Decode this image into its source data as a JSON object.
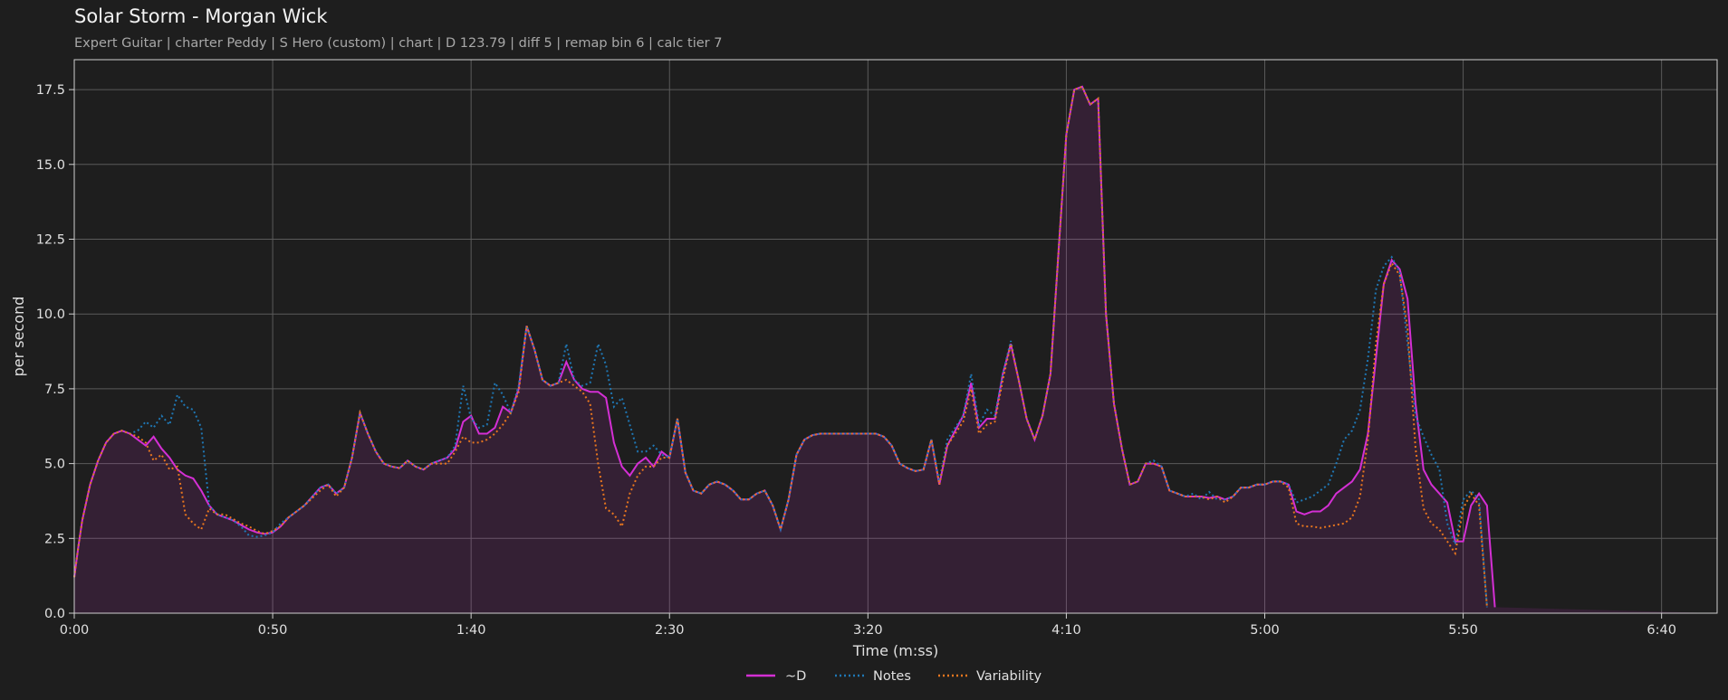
{
  "chart_data": {
    "type": "line",
    "title": "Solar Storm - Morgan Wick",
    "subtitle": "Expert Guitar  |  charter Peddy  |  S Hero (custom)  |  chart  |  D 123.79  |  diff 5  |  remap bin 6  |  calc tier 7",
    "xlabel": "Time (m:ss)",
    "ylabel": "per second",
    "xlim": [
      0,
      414
    ],
    "ylim": [
      0,
      18.5
    ],
    "x_ticks": [
      0,
      50,
      100,
      150,
      200,
      250,
      300,
      350,
      400
    ],
    "x_tick_labels": [
      "0:00",
      "0:50",
      "1:40",
      "2:30",
      "3:20",
      "4:10",
      "5:00",
      "5:50",
      "6:40"
    ],
    "y_ticks": [
      0,
      2.5,
      5,
      7.5,
      10,
      12.5,
      15,
      17.5
    ],
    "y_tick_labels": [
      "0.0",
      "2.5",
      "5.0",
      "7.5",
      "10.0",
      "12.5",
      "15.0",
      "17.5"
    ],
    "grid": true,
    "legend_position": "bottom-center",
    "x": [
      0,
      1,
      2,
      4,
      6,
      8,
      10,
      12,
      14,
      16,
      18,
      20,
      22,
      24,
      26,
      28,
      30,
      32,
      34,
      36,
      38,
      40,
      42,
      44,
      46,
      48,
      50,
      52,
      54,
      56,
      58,
      60,
      62,
      64,
      66,
      68,
      70,
      72,
      74,
      76,
      78,
      80,
      82,
      84,
      86,
      88,
      90,
      92,
      94,
      96,
      98,
      100,
      102,
      104,
      106,
      108,
      110,
      112,
      114,
      116,
      118,
      120,
      122,
      124,
      126,
      128,
      130,
      132,
      134,
      136,
      138,
      140,
      142,
      144,
      146,
      148,
      150,
      152,
      154,
      156,
      158,
      160,
      162,
      164,
      166,
      168,
      170,
      172,
      174,
      176,
      178,
      180,
      182,
      184,
      186,
      188,
      190,
      192,
      194,
      196,
      198,
      200,
      202,
      204,
      206,
      208,
      210,
      212,
      214,
      216,
      218,
      220,
      222,
      224,
      226,
      228,
      230,
      232,
      234,
      236,
      238,
      240,
      242,
      244,
      246,
      248,
      250,
      252,
      254,
      256,
      258,
      260,
      262,
      264,
      266,
      268,
      270,
      272,
      274,
      276,
      278,
      280,
      282,
      284,
      286,
      288,
      290,
      292,
      294,
      296,
      298,
      300,
      302,
      304,
      306,
      308,
      310,
      312,
      314,
      316,
      318,
      320,
      322,
      324,
      326,
      328,
      330,
      332,
      334,
      336,
      338,
      340,
      342,
      344,
      346,
      348,
      350,
      352,
      354,
      356,
      358,
      360,
      362,
      364,
      366,
      368,
      370,
      372,
      374,
      376,
      378,
      380,
      382,
      384,
      386,
      388,
      390,
      392,
      394,
      396,
      398,
      400,
      402,
      404,
      406,
      408,
      410,
      412,
      414
    ],
    "series": [
      {
        "name": "~D",
        "color": "#d42fd4",
        "style": "solid",
        "values": [
          1.2,
          2.2,
          3.1,
          4.3,
          5.1,
          5.7,
          6.0,
          6.1,
          6.0,
          5.8,
          5.6,
          5.9,
          5.5,
          5.2,
          4.8,
          4.6,
          4.5,
          4.1,
          3.6,
          3.3,
          3.2,
          3.1,
          2.95,
          2.8,
          2.7,
          2.65,
          2.7,
          2.9,
          3.2,
          3.4,
          3.6,
          3.9,
          4.2,
          4.3,
          4.0,
          4.2,
          5.2,
          6.7,
          6.0,
          5.4,
          5.0,
          4.9,
          4.85,
          5.1,
          4.9,
          4.8,
          5.0,
          5.1,
          5.2,
          5.5,
          6.4,
          6.6,
          6.0,
          6.0,
          6.2,
          6.9,
          6.7,
          7.5,
          9.6,
          8.8,
          7.8,
          7.6,
          7.7,
          8.4,
          7.8,
          7.5,
          7.4,
          7.4,
          7.2,
          5.7,
          4.9,
          4.6,
          5.0,
          5.2,
          4.9,
          5.4,
          5.2,
          6.5,
          4.7,
          4.1,
          4.0,
          4.3,
          4.4,
          4.3,
          4.1,
          3.8,
          3.8,
          4.0,
          4.1,
          3.6,
          2.8,
          3.8,
          5.3,
          5.8,
          5.95,
          6.0,
          6.0,
          6.0,
          6.0,
          6.0,
          6.0,
          6.0,
          6.0,
          5.9,
          5.6,
          5.0,
          4.85,
          4.75,
          4.8,
          5.8,
          4.3,
          5.6,
          6.1,
          6.6,
          7.7,
          6.2,
          6.5,
          6.5,
          8.0,
          9.0,
          7.8,
          6.5,
          5.8,
          6.6,
          8.0,
          12.0,
          16.0,
          17.5,
          17.6,
          17.0,
          17.2,
          10.0,
          7.0,
          5.5,
          4.3,
          4.4,
          5.0,
          5.0,
          4.9,
          4.1,
          4.0,
          3.9,
          3.9,
          3.9,
          3.85,
          3.9,
          3.8,
          3.9,
          4.2,
          4.2,
          4.3,
          4.3,
          4.4,
          4.4,
          4.3,
          3.4,
          3.3,
          3.4,
          3.4,
          3.6,
          4.0,
          4.2,
          4.4,
          4.8,
          6.0,
          8.5,
          11.0,
          11.8,
          11.5,
          10.5,
          7.0,
          4.8,
          4.3,
          4.0,
          3.7,
          2.4,
          2.4,
          3.6,
          4.0,
          3.6,
          0.2
        ]
      },
      {
        "name": "Notes",
        "color": "#1f77b4",
        "style": "dotted",
        "values": [
          1.2,
          2.2,
          3.1,
          4.3,
          5.1,
          5.7,
          6.0,
          6.1,
          6.0,
          6.1,
          6.4,
          6.2,
          6.6,
          6.3,
          7.3,
          6.9,
          6.8,
          6.2,
          3.6,
          3.3,
          3.2,
          3.1,
          2.9,
          2.6,
          2.55,
          2.6,
          2.7,
          3.0,
          3.2,
          3.4,
          3.6,
          3.9,
          4.2,
          4.3,
          4.0,
          4.2,
          5.2,
          6.7,
          6.0,
          5.4,
          5.0,
          4.9,
          4.85,
          5.1,
          4.9,
          4.8,
          5.0,
          5.1,
          5.2,
          5.6,
          7.6,
          6.5,
          6.2,
          6.3,
          7.7,
          7.3,
          6.7,
          7.6,
          9.6,
          8.8,
          7.8,
          7.6,
          7.7,
          9.0,
          7.8,
          7.6,
          7.7,
          9.0,
          8.3,
          6.9,
          7.2,
          6.3,
          5.4,
          5.4,
          5.6,
          5.3,
          5.2,
          6.5,
          4.7,
          4.1,
          4.0,
          4.3,
          4.4,
          4.3,
          4.1,
          3.8,
          3.8,
          4.0,
          4.1,
          3.6,
          2.8,
          3.8,
          5.3,
          5.8,
          5.95,
          6.0,
          6.0,
          6.0,
          6.0,
          6.0,
          6.0,
          6.0,
          6.0,
          5.9,
          5.6,
          5.0,
          4.85,
          4.75,
          4.8,
          5.8,
          4.4,
          5.8,
          6.2,
          6.6,
          8.0,
          6.3,
          6.8,
          6.6,
          8.0,
          9.1,
          7.8,
          6.5,
          5.8,
          6.6,
          8.0,
          12.0,
          16.0,
          17.5,
          17.6,
          17.0,
          17.2,
          10.0,
          7.0,
          5.5,
          4.3,
          4.4,
          5.0,
          5.1,
          4.9,
          4.1,
          4.0,
          3.9,
          4.0,
          3.8,
          4.05,
          3.8,
          3.8,
          3.9,
          4.2,
          4.2,
          4.3,
          4.3,
          4.4,
          4.4,
          4.3,
          3.7,
          3.8,
          3.9,
          4.1,
          4.3,
          5.0,
          5.8,
          6.1,
          6.8,
          8.5,
          10.8,
          11.6,
          11.9,
          11.4,
          9.0,
          6.6,
          5.9,
          5.3,
          4.8,
          3.0,
          2.3,
          3.8,
          4.1,
          3.8,
          0.2
        ]
      },
      {
        "name": "Variability",
        "color": "#e8761e",
        "style": "dotted",
        "values": [
          1.2,
          2.2,
          3.1,
          4.3,
          5.1,
          5.7,
          6.0,
          6.1,
          6.0,
          5.9,
          5.7,
          5.1,
          5.3,
          4.8,
          4.9,
          3.3,
          3.0,
          2.8,
          3.5,
          3.3,
          3.3,
          3.15,
          3.0,
          2.9,
          2.75,
          2.65,
          2.75,
          2.9,
          3.2,
          3.4,
          3.6,
          3.85,
          4.1,
          4.3,
          3.9,
          4.2,
          5.2,
          6.7,
          6.0,
          5.4,
          5.0,
          4.9,
          4.85,
          5.1,
          4.9,
          4.8,
          5.0,
          5.0,
          5.0,
          5.4,
          5.9,
          5.7,
          5.7,
          5.8,
          6.0,
          6.3,
          6.7,
          7.4,
          9.6,
          8.8,
          7.8,
          7.6,
          7.7,
          7.8,
          7.6,
          7.4,
          7.0,
          5.0,
          3.5,
          3.3,
          2.9,
          4.0,
          4.6,
          4.9,
          4.9,
          5.2,
          5.2,
          6.5,
          4.7,
          4.1,
          4.0,
          4.3,
          4.4,
          4.3,
          4.1,
          3.8,
          3.8,
          4.0,
          4.1,
          3.6,
          2.8,
          3.8,
          5.3,
          5.8,
          5.95,
          6.0,
          6.0,
          6.0,
          6.0,
          6.0,
          6.0,
          6.0,
          6.0,
          5.9,
          5.6,
          5.0,
          4.85,
          4.75,
          4.8,
          5.8,
          4.3,
          5.6,
          6.0,
          6.4,
          7.5,
          6.0,
          6.3,
          6.4,
          7.8,
          9.0,
          7.8,
          6.5,
          5.8,
          6.6,
          8.0,
          12.0,
          16.0,
          17.5,
          17.6,
          17.0,
          17.2,
          10.0,
          7.0,
          5.5,
          4.3,
          4.4,
          5.0,
          5.0,
          4.9,
          4.1,
          4.0,
          3.9,
          3.9,
          3.9,
          3.8,
          3.9,
          3.7,
          3.9,
          4.2,
          4.2,
          4.3,
          4.3,
          4.4,
          4.4,
          4.2,
          3.0,
          2.9,
          2.9,
          2.85,
          2.9,
          2.95,
          3.0,
          3.2,
          3.9,
          5.8,
          9.0,
          11.0,
          11.7,
          11.3,
          9.5,
          5.5,
          3.5,
          3.0,
          2.8,
          2.4,
          2.0,
          3.5,
          4.0,
          3.6,
          0.2
        ]
      }
    ]
  }
}
